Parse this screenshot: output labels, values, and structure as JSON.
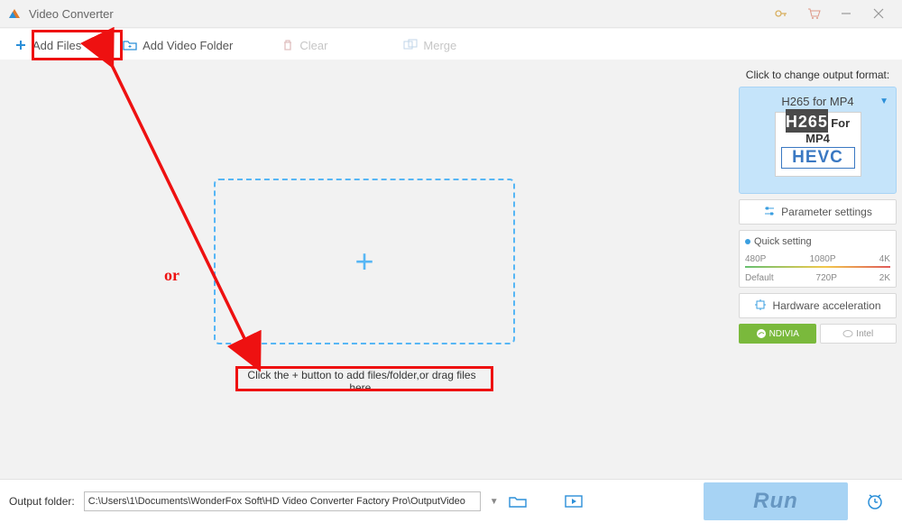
{
  "titlebar": {
    "title": "Video Converter"
  },
  "toolbar": {
    "add_files": "Add Files",
    "add_folder": "Add Video Folder",
    "clear": "Clear",
    "merge": "Merge"
  },
  "drop": {
    "hint": "Click the + button to add files/folder,or drag files here."
  },
  "annot": {
    "or": "or"
  },
  "side": {
    "format_hint": "Click to change output format:",
    "format_name": "H265 for MP4",
    "badge_row1": "H265",
    "badge_row2": "For MP4",
    "badge_row3": "HEVC",
    "param_settings": "Parameter settings",
    "quick_title": "Quick setting",
    "ticks_top": [
      "480P",
      "1080P",
      "4K"
    ],
    "ticks_bottom": [
      "Default",
      "720P",
      "2K"
    ],
    "hw_accel": "Hardware acceleration",
    "nvidia": "NDIVIA",
    "intel": "Intel"
  },
  "bottom": {
    "label": "Output folder:",
    "path": "C:\\Users\\1\\Documents\\WonderFox Soft\\HD Video Converter Factory Pro\\OutputVideo",
    "run": "Run"
  }
}
